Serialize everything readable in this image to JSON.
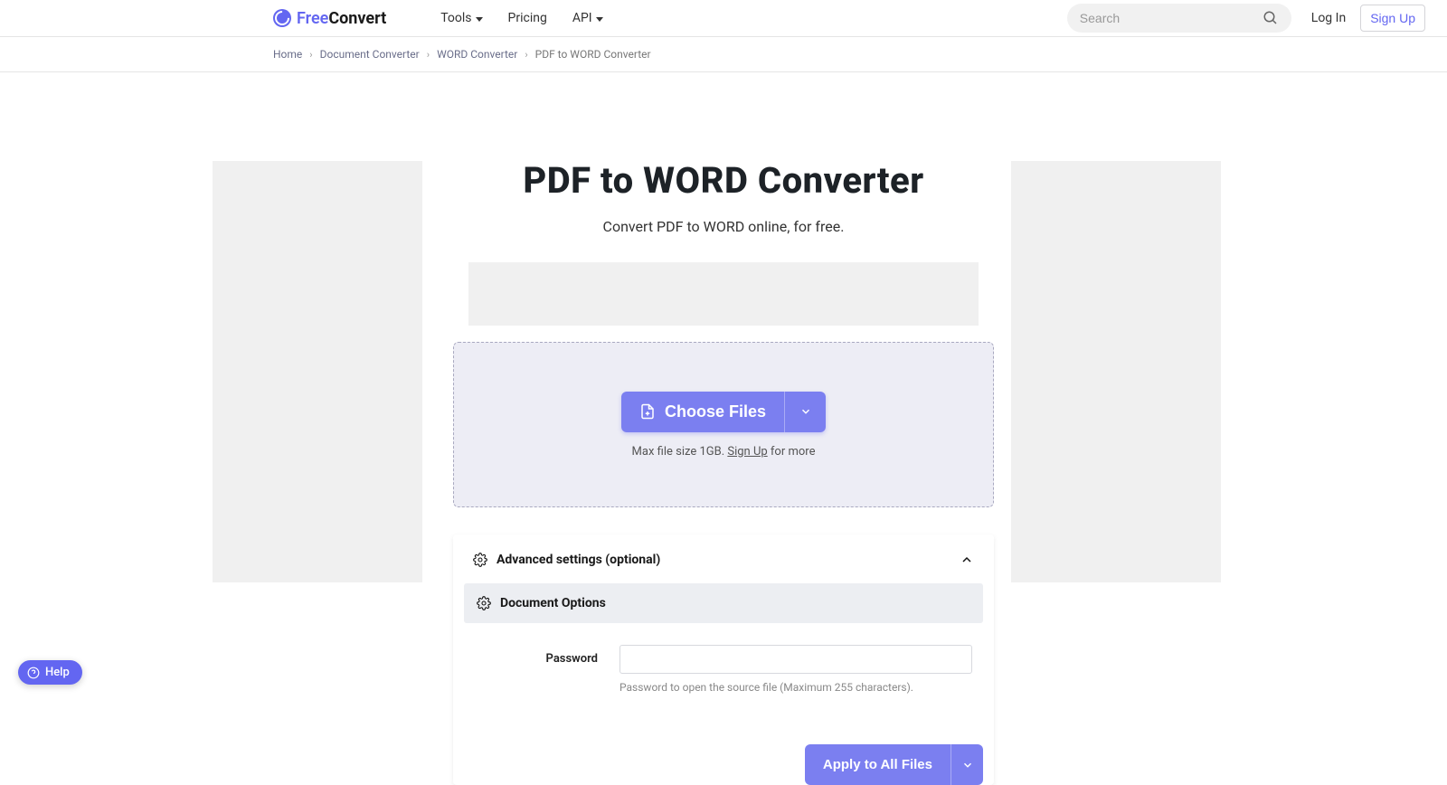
{
  "header": {
    "logo_free": "Free",
    "logo_convert": "Convert",
    "nav": {
      "tools": "Tools",
      "pricing": "Pricing",
      "api": "API"
    },
    "search_placeholder": "Search",
    "login": "Log In",
    "signup": "Sign Up"
  },
  "breadcrumb": {
    "home": "Home",
    "doc_converter": "Document Converter",
    "word_converter": "WORD Converter",
    "current": "PDF to WORD Converter"
  },
  "main": {
    "title": "PDF to WORD Converter",
    "subtitle": "Convert PDF to WORD online, for free.",
    "choose_files": "Choose Files",
    "size_note_prefix": "Max file size 1GB. ",
    "size_note_link": "Sign Up",
    "size_note_suffix": " for more"
  },
  "settings": {
    "header": "Advanced settings (optional)",
    "section": "Document Options",
    "password_label": "Password",
    "password_help": "Password to open the source file (Maximum 255 characters).",
    "apply": "Apply to All Files"
  },
  "help_label": "Help"
}
